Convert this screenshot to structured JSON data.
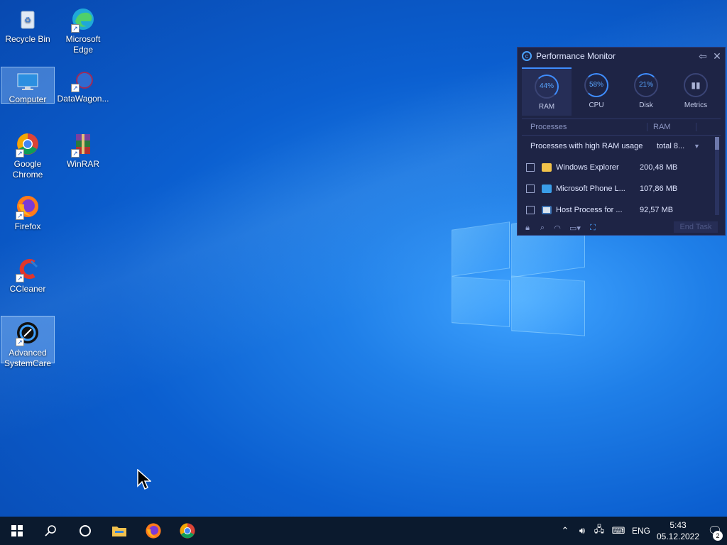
{
  "desktop": {
    "icons": [
      {
        "label": "Recycle Bin"
      },
      {
        "label": "Microsoft Edge"
      },
      {
        "label": "Computer"
      },
      {
        "label": "DataWagon..."
      },
      {
        "label": "Google Chrome"
      },
      {
        "label": "WinRAR"
      },
      {
        "label": "Firefox"
      },
      {
        "label": "CCleaner"
      },
      {
        "label": "Advanced SystemCare"
      }
    ]
  },
  "perf_monitor": {
    "title": "Performance Monitor",
    "tabs": [
      {
        "label": "RAM",
        "value": "44%"
      },
      {
        "label": "CPU",
        "value": "58%"
      },
      {
        "label": "Disk",
        "value": "21%"
      },
      {
        "label": "Metrics",
        "value": "∣"
      }
    ],
    "table": {
      "col_processes": "Processes",
      "col_ram": "RAM",
      "group_label": "Processes with high RAM usage",
      "group_total": "total 8...",
      "rows": [
        {
          "name": "Windows Explorer",
          "ram": "200,48 MB"
        },
        {
          "name": "Microsoft Phone L...",
          "ram": "107,86 MB"
        },
        {
          "name": "Host Process for ...",
          "ram": "92,57 MB"
        }
      ]
    },
    "end_task_label": "End Task"
  },
  "taskbar": {
    "language": "ENG",
    "time": "5:43",
    "date": "05.12.2022",
    "notification_count": "2"
  },
  "colors": {
    "accent": "#3f8dff",
    "panel_bg": "#1e2445",
    "taskbar_bg": "#0b1a2e"
  }
}
